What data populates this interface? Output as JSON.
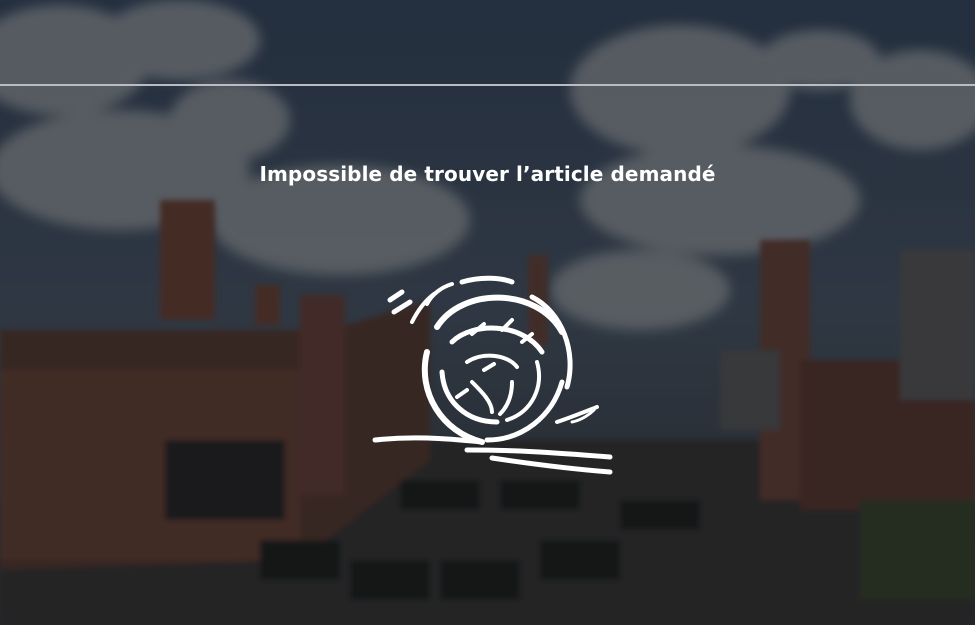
{
  "error": {
    "message": "Impossible de trouver l’article demandé",
    "illustration_icon": "tumbleweed-icon"
  },
  "colors": {
    "text": "#ffffff",
    "rule": "#b9bcc2",
    "overlay": "rgba(0,0,0,0.38)"
  }
}
